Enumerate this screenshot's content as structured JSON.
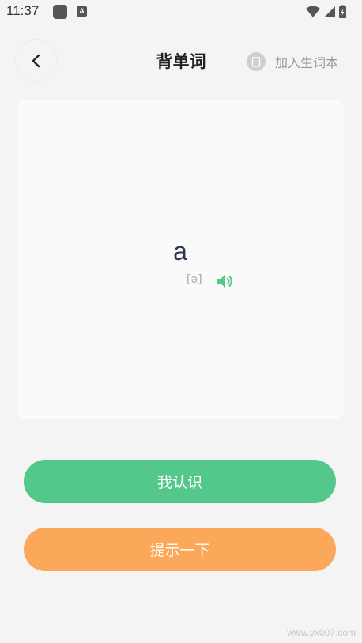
{
  "status_bar": {
    "time": "11:37",
    "notification_icons": [
      "app-icon",
      "a-icon"
    ],
    "notification_a_glyph": "A",
    "system_icons": [
      "wifi-icon",
      "signal-icon",
      "battery-charging-icon"
    ]
  },
  "header": {
    "back_icon": "chevron-left-icon",
    "title": "背单词",
    "add_vocab_label": "加入生词本",
    "add_vocab_icon": "notebook-icon"
  },
  "word_card": {
    "word": "a",
    "phonetic": "[ə]",
    "speaker_icon": "speaker-icon"
  },
  "actions": {
    "know_label": "我认识",
    "hint_label": "提示一下"
  },
  "watermark": "www.yx007.com",
  "colors": {
    "background": "#f4f4f4",
    "card": "#fafafa",
    "know_button": "#54c88b",
    "hint_button": "#fca85a",
    "speaker": "#54c88b",
    "word": "#2c3650"
  }
}
